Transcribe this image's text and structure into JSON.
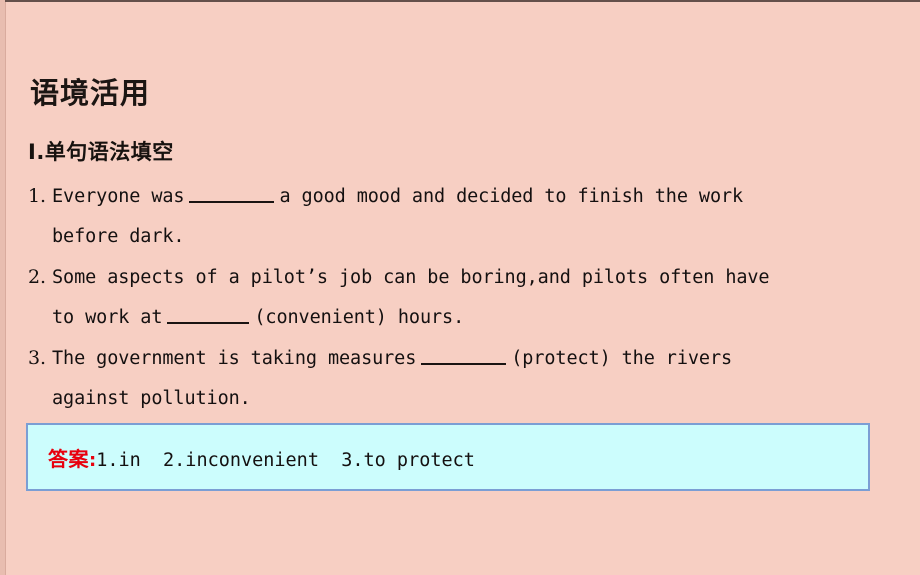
{
  "slide": {
    "background_color": "#f7cfc3",
    "title": "语境活用",
    "section_title": "Ⅰ.单句语法填空"
  },
  "questions": [
    {
      "number": "1.",
      "line1_before_blank": "Everyone was",
      "line1_after_blank": "a good mood and decided to finish the work",
      "line2": "before dark."
    },
    {
      "number": "2.",
      "line1": "Some aspects of a pilot’s job can be boring,and pilots often have",
      "line2_before_blank": "to work at",
      "line2_after_blank": "(convenient) hours."
    },
    {
      "number": "3.",
      "line1_before_blank": "The government is taking measures",
      "line1_after_blank": "(protect) the rivers",
      "line2": "against pollution."
    }
  ],
  "answer": {
    "label": "答案",
    "colon": ":",
    "label_color": "#e8000d",
    "box_background": "#ccfdfd",
    "box_border_color": "#7b9ed4",
    "text": "1.in  2.inconvenient  3.to protect"
  }
}
